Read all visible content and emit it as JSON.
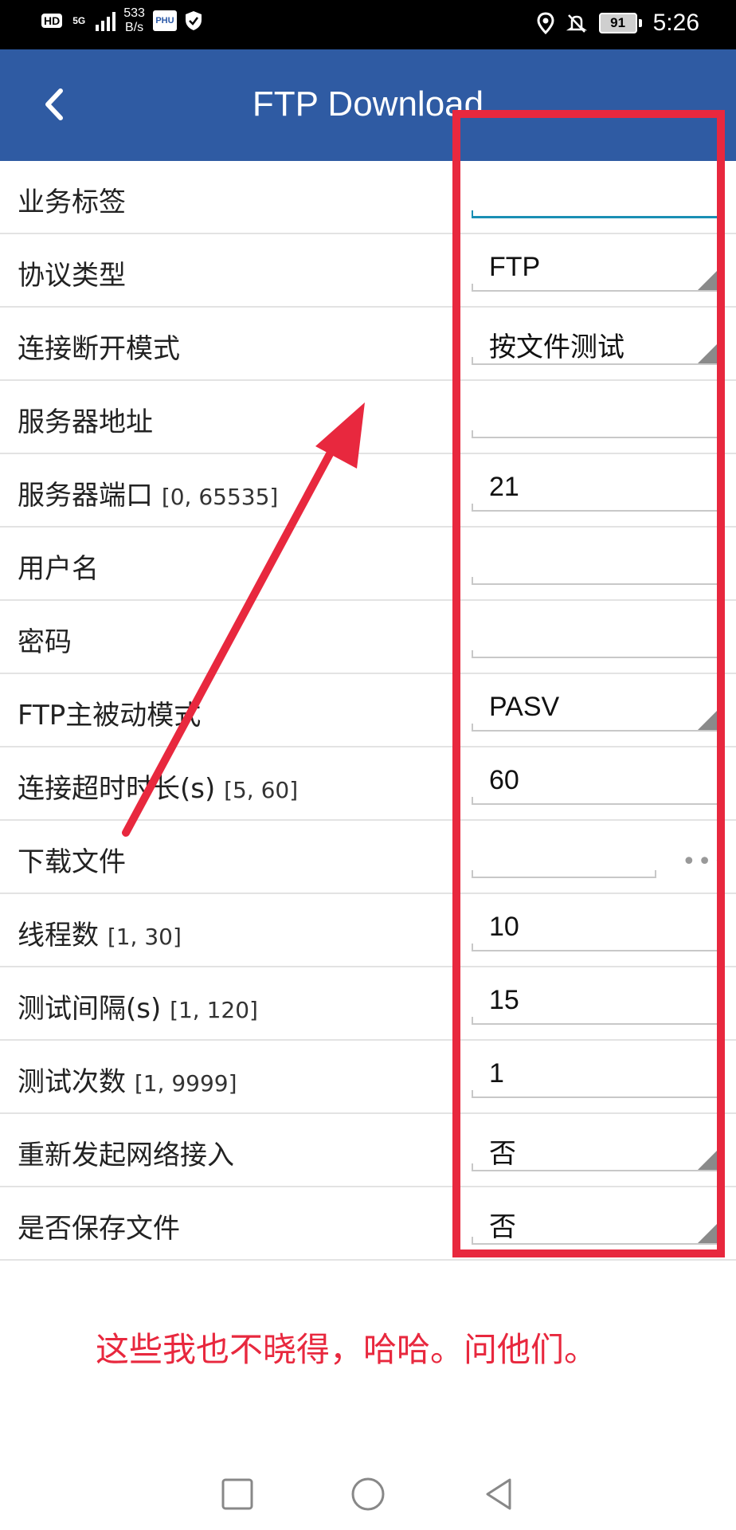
{
  "statusbar": {
    "hd": "HD",
    "net": "5G",
    "speed_value": "533",
    "speed_unit": "B/s",
    "app_badge": "PHU",
    "battery": "91",
    "time": "5:26"
  },
  "header": {
    "title": "FTP Download"
  },
  "rows": [
    {
      "label": "业务标签",
      "range": "",
      "value": "",
      "type": "text-active"
    },
    {
      "label": "协议类型",
      "range": "",
      "value": "FTP",
      "type": "select"
    },
    {
      "label": "连接断开模式",
      "range": "",
      "value": "按文件测试",
      "type": "select"
    },
    {
      "label": "服务器地址",
      "range": "",
      "value": "",
      "type": "text"
    },
    {
      "label": "服务器端口",
      "range": "[0, 65535]",
      "value": "21",
      "type": "text"
    },
    {
      "label": "用户名",
      "range": "",
      "value": "",
      "type": "text"
    },
    {
      "label": "密码",
      "range": "",
      "value": "",
      "type": "text"
    },
    {
      "label": "FTP主被动模式",
      "range": "",
      "value": "PASV",
      "type": "select"
    },
    {
      "label": "连接超时时长(s)",
      "range": "[5, 60]",
      "value": "60",
      "type": "text"
    },
    {
      "label": "下载文件",
      "range": "",
      "value": "",
      "type": "file",
      "more": "•••"
    },
    {
      "label": "线程数",
      "range": "[1, 30]",
      "value": "10",
      "type": "text"
    },
    {
      "label": "测试间隔(s)",
      "range": "[1, 120]",
      "value": "15",
      "type": "text"
    },
    {
      "label": "测试次数",
      "range": "[1, 9999]",
      "value": "1",
      "type": "text"
    },
    {
      "label": "重新发起网络接入",
      "range": "",
      "value": "否",
      "type": "select"
    },
    {
      "label": "是否保存文件",
      "range": "",
      "value": "否",
      "type": "select"
    }
  ],
  "annotation": {
    "note": "这些我也不晓得，哈哈。问他们。",
    "color": "#e8283e"
  },
  "colors": {
    "header": "#2f5ba3",
    "active_underline": "#1a8fb4"
  }
}
